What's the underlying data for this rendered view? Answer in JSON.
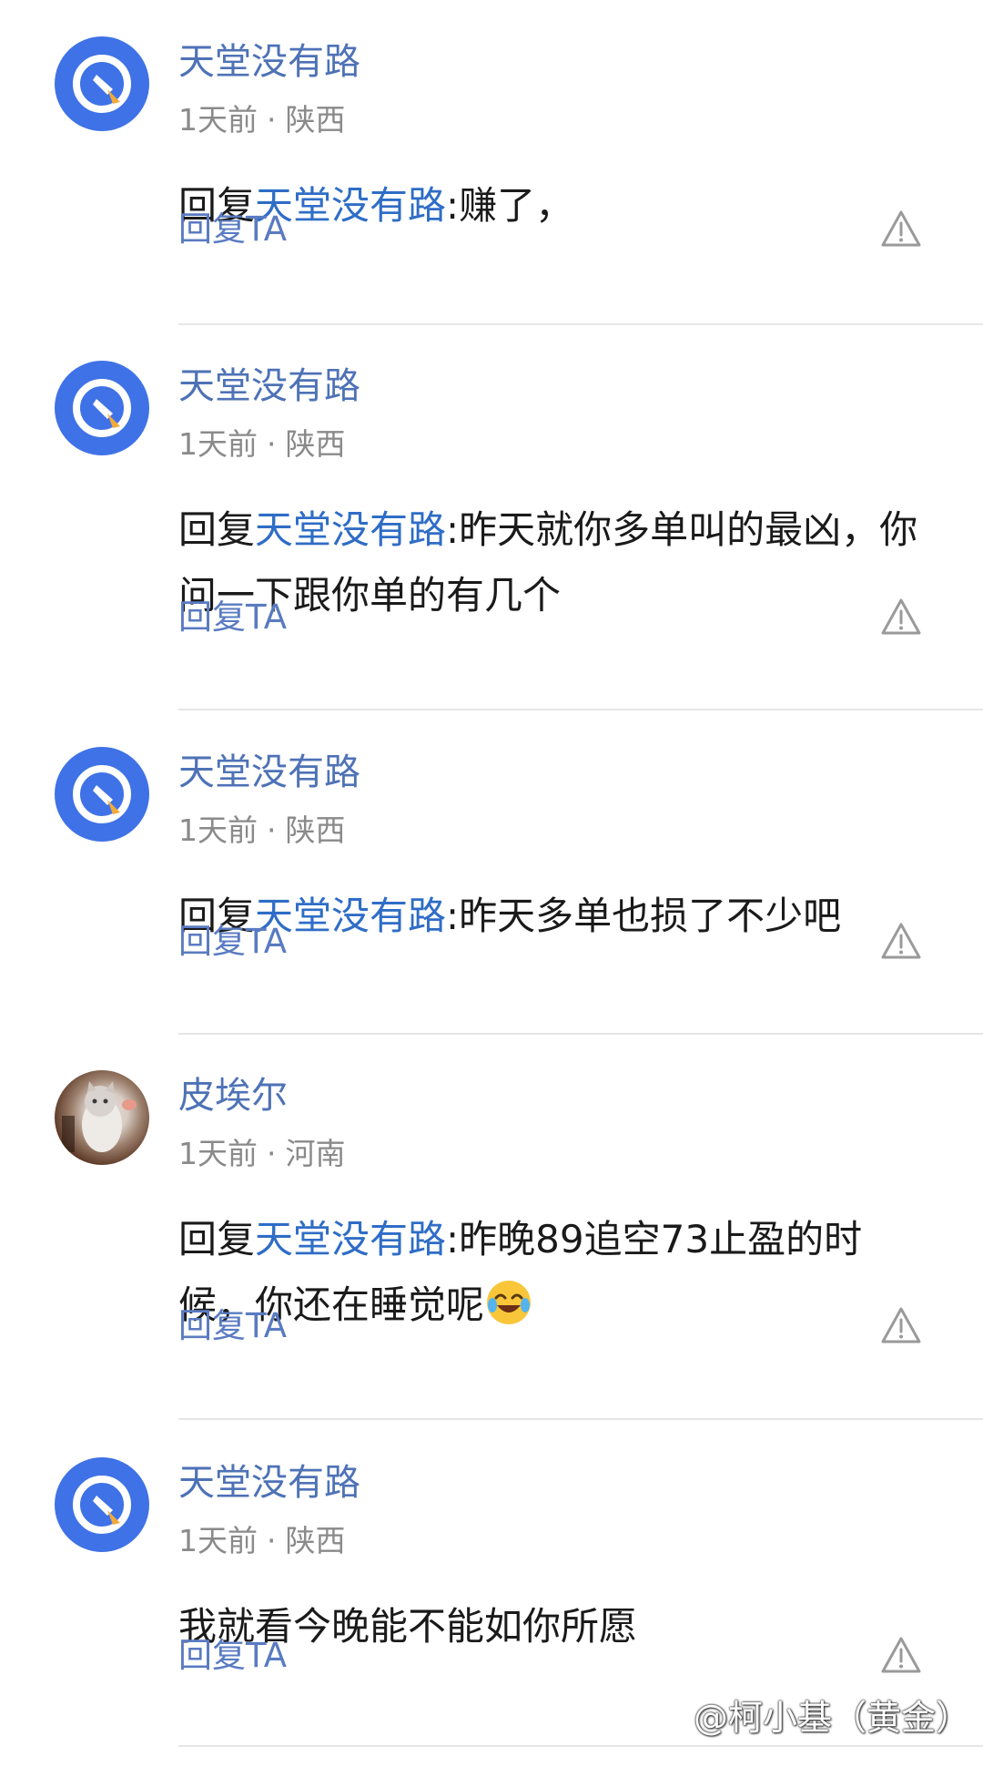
{
  "comments": [
    {
      "user": "天堂没有路",
      "time": "1天前",
      "sep": "·",
      "location": "陕西",
      "prefix": "回复",
      "mention": "天堂没有路",
      "text": ":赚了，",
      "reply_label": "回复TA",
      "avatar_icon": "rocket-icon"
    },
    {
      "user": "天堂没有路",
      "time": "1天前",
      "sep": "·",
      "location": "陕西",
      "prefix": "回复",
      "mention": "天堂没有路",
      "text": ":昨天就你多单叫的最凶，你问一下跟你单的有几个",
      "reply_label": "回复TA",
      "avatar_icon": "rocket-icon"
    },
    {
      "user": "天堂没有路",
      "time": "1天前",
      "sep": "·",
      "location": "陕西",
      "prefix": "回复",
      "mention": "天堂没有路",
      "text": ":昨天多单也损了不少吧",
      "reply_label": "回复TA",
      "avatar_icon": "rocket-icon"
    },
    {
      "user": "皮埃尔",
      "time": "1天前",
      "sep": "·",
      "location": "河南",
      "prefix": "回复",
      "mention": "天堂没有路",
      "text": ":昨晚89追空73止盈的时候，你还在睡觉呢",
      "emoji": "laughing-crying-emoji",
      "reply_label": "回复TA",
      "avatar_icon": "cat-photo"
    },
    {
      "user": "天堂没有路",
      "time": "1天前",
      "sep": "·",
      "location": "陕西",
      "text": "我就看今晚能不能如你所愿",
      "reply_label": "回复TA",
      "avatar_icon": "rocket-icon"
    }
  ],
  "watermark": "@柯小基（黄金）",
  "icons": {
    "report": "warning-triangle-icon",
    "watermark_logo": "brand-logo-icon"
  },
  "colors": {
    "username": "#4e72b6",
    "mention": "#2f6dc6",
    "reply": "#5a7bc2",
    "meta": "#8a8a8a",
    "avatar_bg": "#3f72e6"
  }
}
